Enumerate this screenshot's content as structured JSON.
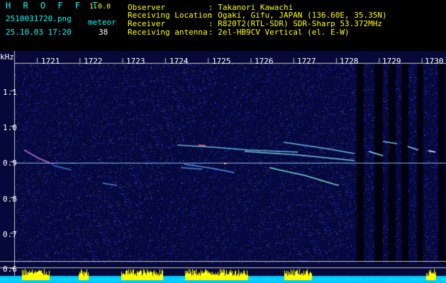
{
  "app": {
    "title": "H R O F F T",
    "version": "1.0.0"
  },
  "file": {
    "name": "2510031720.png",
    "datetime": "25.10.03 17:20"
  },
  "meteor": {
    "label": "meteor",
    "count": "38"
  },
  "info": {
    "rows": [
      {
        "label": "Observer",
        "value": ": Takanori Kawachi"
      },
      {
        "label": "Receiving Location",
        "value": ": Ogaki, Gifu, JAPAN (136.60E, 35.35N)"
      },
      {
        "label": "Receiver",
        "value": ": R820T2(RTL-SDR) SDR-Sharp 53.372MHz"
      },
      {
        "label": "Receiving antenna",
        "value": ": 2el-HB9CV Vertical (el. E-W)"
      }
    ]
  },
  "axes": {
    "y_unit": "kHz",
    "y_ticks": [
      "1.1",
      "1.0",
      "0.9",
      "0.8",
      "0.7",
      "0.6"
    ],
    "x_ticks": [
      "1721",
      "1722",
      "1723",
      "1724",
      "1725",
      "1726",
      "1727",
      "1728",
      "1729",
      "1730"
    ]
  },
  "colors": {
    "background": "#000000",
    "plot_bg": "#050838",
    "header_cyan": "#00ffff",
    "header_yellow": "#ffff00",
    "carrier": "#9ad7ff",
    "power_cyan": "#00c8ff",
    "power_yellow": "#ffff00"
  }
}
